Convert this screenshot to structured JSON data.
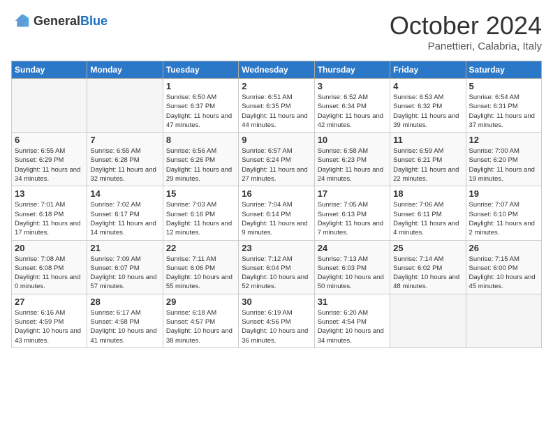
{
  "header": {
    "logo": {
      "general": "General",
      "blue": "Blue"
    },
    "title": "October 2024",
    "location": "Panettieri, Calabria, Italy"
  },
  "days_of_week": [
    "Sunday",
    "Monday",
    "Tuesday",
    "Wednesday",
    "Thursday",
    "Friday",
    "Saturday"
  ],
  "weeks": [
    [
      {
        "day": "",
        "info": ""
      },
      {
        "day": "",
        "info": ""
      },
      {
        "day": "1",
        "info": "Sunrise: 6:50 AM\nSunset: 6:37 PM\nDaylight: 11 hours and 47 minutes."
      },
      {
        "day": "2",
        "info": "Sunrise: 6:51 AM\nSunset: 6:35 PM\nDaylight: 11 hours and 44 minutes."
      },
      {
        "day": "3",
        "info": "Sunrise: 6:52 AM\nSunset: 6:34 PM\nDaylight: 11 hours and 42 minutes."
      },
      {
        "day": "4",
        "info": "Sunrise: 6:53 AM\nSunset: 6:32 PM\nDaylight: 11 hours and 39 minutes."
      },
      {
        "day": "5",
        "info": "Sunrise: 6:54 AM\nSunset: 6:31 PM\nDaylight: 11 hours and 37 minutes."
      }
    ],
    [
      {
        "day": "6",
        "info": "Sunrise: 6:55 AM\nSunset: 6:29 PM\nDaylight: 11 hours and 34 minutes."
      },
      {
        "day": "7",
        "info": "Sunrise: 6:55 AM\nSunset: 6:28 PM\nDaylight: 11 hours and 32 minutes."
      },
      {
        "day": "8",
        "info": "Sunrise: 6:56 AM\nSunset: 6:26 PM\nDaylight: 11 hours and 29 minutes."
      },
      {
        "day": "9",
        "info": "Sunrise: 6:57 AM\nSunset: 6:24 PM\nDaylight: 11 hours and 27 minutes."
      },
      {
        "day": "10",
        "info": "Sunrise: 6:58 AM\nSunset: 6:23 PM\nDaylight: 11 hours and 24 minutes."
      },
      {
        "day": "11",
        "info": "Sunrise: 6:59 AM\nSunset: 6:21 PM\nDaylight: 11 hours and 22 minutes."
      },
      {
        "day": "12",
        "info": "Sunrise: 7:00 AM\nSunset: 6:20 PM\nDaylight: 11 hours and 19 minutes."
      }
    ],
    [
      {
        "day": "13",
        "info": "Sunrise: 7:01 AM\nSunset: 6:18 PM\nDaylight: 11 hours and 17 minutes."
      },
      {
        "day": "14",
        "info": "Sunrise: 7:02 AM\nSunset: 6:17 PM\nDaylight: 11 hours and 14 minutes."
      },
      {
        "day": "15",
        "info": "Sunrise: 7:03 AM\nSunset: 6:16 PM\nDaylight: 11 hours and 12 minutes."
      },
      {
        "day": "16",
        "info": "Sunrise: 7:04 AM\nSunset: 6:14 PM\nDaylight: 11 hours and 9 minutes."
      },
      {
        "day": "17",
        "info": "Sunrise: 7:05 AM\nSunset: 6:13 PM\nDaylight: 11 hours and 7 minutes."
      },
      {
        "day": "18",
        "info": "Sunrise: 7:06 AM\nSunset: 6:11 PM\nDaylight: 11 hours and 4 minutes."
      },
      {
        "day": "19",
        "info": "Sunrise: 7:07 AM\nSunset: 6:10 PM\nDaylight: 11 hours and 2 minutes."
      }
    ],
    [
      {
        "day": "20",
        "info": "Sunrise: 7:08 AM\nSunset: 6:08 PM\nDaylight: 11 hours and 0 minutes."
      },
      {
        "day": "21",
        "info": "Sunrise: 7:09 AM\nSunset: 6:07 PM\nDaylight: 10 hours and 57 minutes."
      },
      {
        "day": "22",
        "info": "Sunrise: 7:11 AM\nSunset: 6:06 PM\nDaylight: 10 hours and 55 minutes."
      },
      {
        "day": "23",
        "info": "Sunrise: 7:12 AM\nSunset: 6:04 PM\nDaylight: 10 hours and 52 minutes."
      },
      {
        "day": "24",
        "info": "Sunrise: 7:13 AM\nSunset: 6:03 PM\nDaylight: 10 hours and 50 minutes."
      },
      {
        "day": "25",
        "info": "Sunrise: 7:14 AM\nSunset: 6:02 PM\nDaylight: 10 hours and 48 minutes."
      },
      {
        "day": "26",
        "info": "Sunrise: 7:15 AM\nSunset: 6:00 PM\nDaylight: 10 hours and 45 minutes."
      }
    ],
    [
      {
        "day": "27",
        "info": "Sunrise: 6:16 AM\nSunset: 4:59 PM\nDaylight: 10 hours and 43 minutes."
      },
      {
        "day": "28",
        "info": "Sunrise: 6:17 AM\nSunset: 4:58 PM\nDaylight: 10 hours and 41 minutes."
      },
      {
        "day": "29",
        "info": "Sunrise: 6:18 AM\nSunset: 4:57 PM\nDaylight: 10 hours and 38 minutes."
      },
      {
        "day": "30",
        "info": "Sunrise: 6:19 AM\nSunset: 4:56 PM\nDaylight: 10 hours and 36 minutes."
      },
      {
        "day": "31",
        "info": "Sunrise: 6:20 AM\nSunset: 4:54 PM\nDaylight: 10 hours and 34 minutes."
      },
      {
        "day": "",
        "info": ""
      },
      {
        "day": "",
        "info": ""
      }
    ]
  ]
}
